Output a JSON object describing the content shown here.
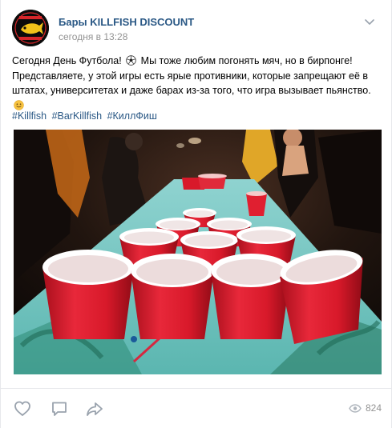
{
  "post": {
    "author": "Бары KILLFISH DISCOUNT",
    "date": "сегодня в 13:28",
    "avatar_alt": "KILLFISH DISCOUNT BAR",
    "text_line1_a": "Сегодня День Футбола! ",
    "text_line1_b": " Мы тоже любим погонять мяч, но в бирпонге!",
    "text_line2": "Представляете, у этой игры есть ярые противники, которые запрещают её в штатах, университетах и даже барах из-за того, что игра вызывает пьянство. ",
    "hashtags": [
      "#Killfish",
      "#BarKillfish",
      "#КиллФиш"
    ],
    "views": "824"
  },
  "icons": {
    "more": "chevron-down-icon",
    "like": "heart-icon",
    "comment": "comment-icon",
    "share": "share-arrow-icon",
    "views": "eye-icon"
  },
  "colors": {
    "link": "#2a5885",
    "muted": "#939393",
    "cup_red": "#d8192a",
    "border": "#e7e8ec"
  }
}
